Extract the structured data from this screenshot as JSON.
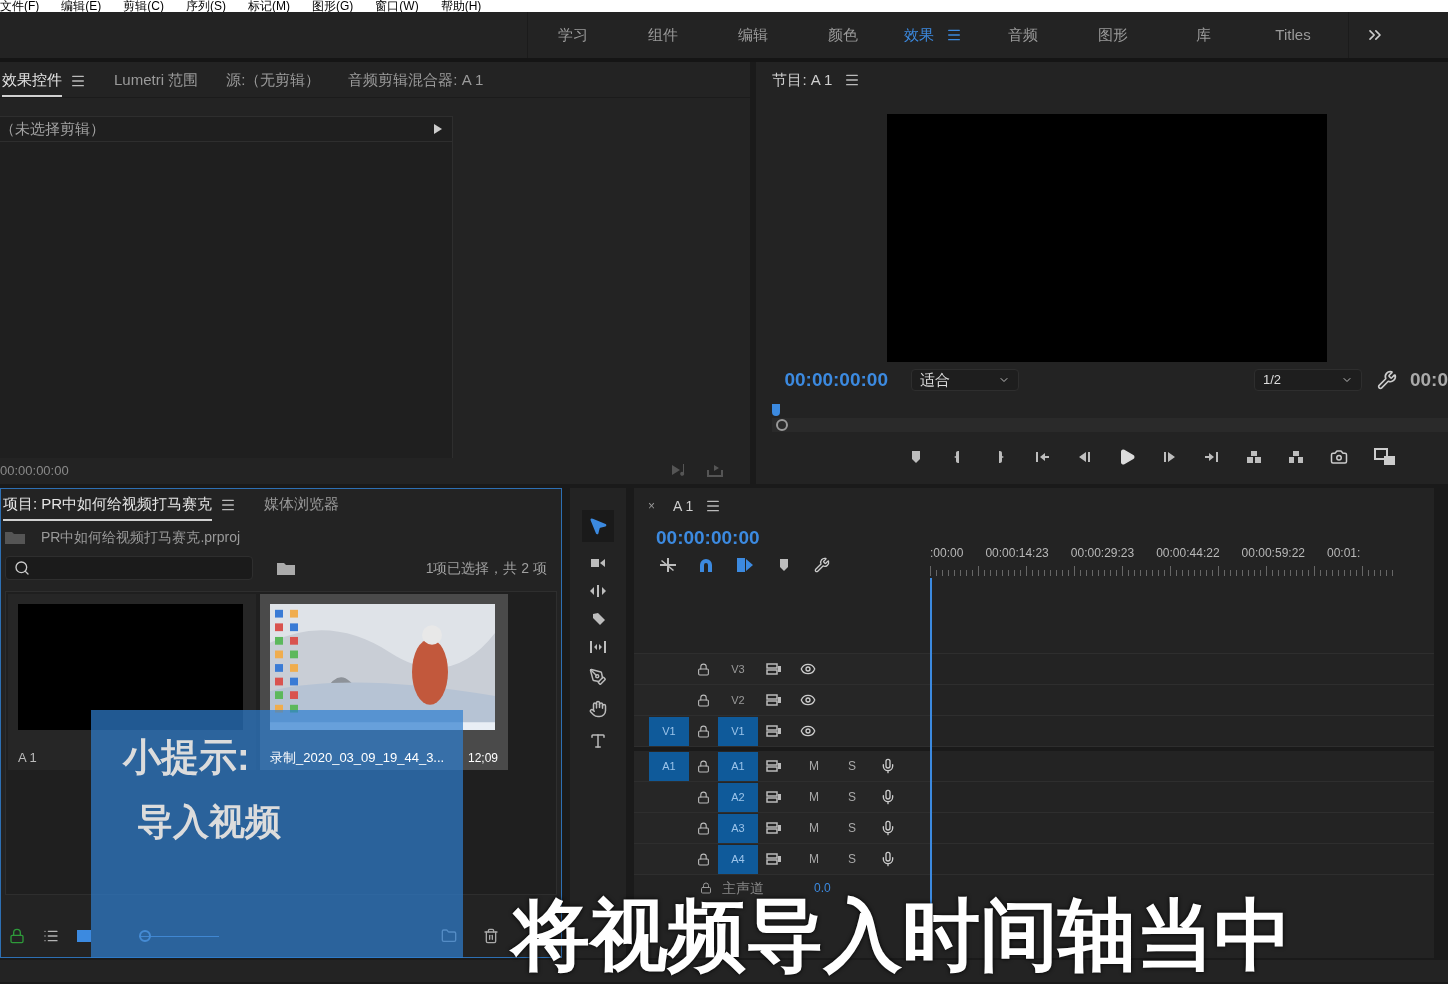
{
  "menu": [
    "文件(F)",
    "编辑(E)",
    "剪辑(C)",
    "序列(S)",
    "标记(M)",
    "图形(G)",
    "窗口(W)",
    "帮助(H)"
  ],
  "workspaces": [
    {
      "label": "学习",
      "selected": false
    },
    {
      "label": "组件",
      "selected": false
    },
    {
      "label": "编辑",
      "selected": false
    },
    {
      "label": "颜色",
      "selected": false
    },
    {
      "label": "效果",
      "selected": true
    },
    {
      "label": "音频",
      "selected": false
    },
    {
      "label": "图形",
      "selected": false
    },
    {
      "label": "库",
      "selected": false
    },
    {
      "label": "Titles",
      "selected": false
    }
  ],
  "effects_panel": {
    "tabs": [
      {
        "label": "效果控件",
        "selected": true
      },
      {
        "label": "Lumetri 范围",
        "selected": false
      },
      {
        "label": "源:（无剪辑）",
        "selected": false
      },
      {
        "label": "音频剪辑混合器: A 1",
        "selected": false
      }
    ],
    "clip_header": "（未选择剪辑）",
    "timecode": "00:00:00:00"
  },
  "program_monitor": {
    "title": "节目: A 1",
    "timecode": "00:00:00:00",
    "zoom": "适合",
    "resolution": "1/2",
    "duration": "00:0"
  },
  "project_panel": {
    "tabs": [
      {
        "label": "项目: PR中如何给视频打马赛克",
        "selected": true
      },
      {
        "label": "媒体浏览器",
        "selected": false
      }
    ],
    "file": "PR中如何给视频打马赛克.prproj",
    "selection_info": "1项已选择，共 2 项",
    "items": [
      {
        "kind": "sequence",
        "name": "A 1",
        "selected": false
      },
      {
        "kind": "picture",
        "name": "录制_2020_03_09_19_44_3...",
        "duration": "12;09",
        "selected": true
      }
    ]
  },
  "zoom_slider": {
    "level": 0
  },
  "timeline": {
    "close": "×",
    "title": "A 1",
    "timecode": "00:00:00:00",
    "ruler": [
      ":00:00",
      "00:00:14:23",
      "00:00:29:23",
      "00:00:44:22",
      "00:00:59:22",
      "00:01:"
    ],
    "tracks": [
      {
        "kind": "video",
        "label": "V3",
        "targeted": false
      },
      {
        "kind": "video",
        "label": "V2",
        "targeted": false
      },
      {
        "kind": "video",
        "label": "V1",
        "source": "V1",
        "targeted": true
      },
      {
        "kind": "audio",
        "label": "A1",
        "source": "A1",
        "targeted": true,
        "mute": "M",
        "solo": "S"
      },
      {
        "kind": "audio",
        "label": "A2",
        "targeted": true,
        "mute": "M",
        "solo": "S"
      },
      {
        "kind": "audio",
        "label": "A3",
        "targeted": true,
        "mute": "M",
        "solo": "S"
      },
      {
        "kind": "audio",
        "label": "A4",
        "targeted": true,
        "mute": "M",
        "solo": "S"
      }
    ],
    "master": {
      "label": "主声道",
      "value": "0.0"
    }
  },
  "tip": {
    "title": "小提示:",
    "body": "导入视频"
  },
  "subtitle": "将视频导入时间轴当中"
}
